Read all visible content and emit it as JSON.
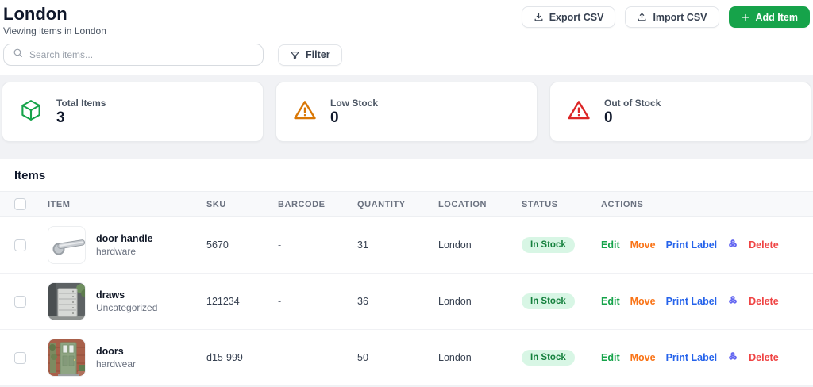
{
  "header": {
    "title": "London",
    "subtitle": "Viewing items in London",
    "export_label": "Export CSV",
    "import_label": "Import CSV",
    "add_label": "Add Item"
  },
  "toolbar": {
    "search_placeholder": "Search items...",
    "filter_label": "Filter"
  },
  "stats": [
    {
      "label": "Total Items",
      "value": "3",
      "icon": "package-icon"
    },
    {
      "label": "Low Stock",
      "value": "0",
      "icon": "warning-triangle-amber-icon"
    },
    {
      "label": "Out of Stock",
      "value": "0",
      "icon": "warning-triangle-red-icon"
    }
  ],
  "table": {
    "section_title": "Items",
    "columns": [
      "ITEM",
      "SKU",
      "BARCODE",
      "QUANTITY",
      "LOCATION",
      "STATUS",
      "ACTIONS"
    ],
    "actions": {
      "edit": "Edit",
      "move": "Move",
      "print_label": "Print Label",
      "delete": "Delete"
    },
    "rows": [
      {
        "name": "door handle",
        "category": "hardware",
        "sku": "5670",
        "barcode": "-",
        "quantity": "31",
        "location": "London",
        "status": "In Stock",
        "thumb": "door-handle-photo"
      },
      {
        "name": "draws",
        "category": "Uncategorized",
        "sku": "121234",
        "barcode": "-",
        "quantity": "36",
        "location": "London",
        "status": "In Stock",
        "thumb": "drawer-unit-photo"
      },
      {
        "name": "doors",
        "category": "hardwear",
        "sku": "d15-999",
        "barcode": "-",
        "quantity": "50",
        "location": "London",
        "status": "In Stock",
        "thumb": "green-door-photo"
      }
    ]
  },
  "colors": {
    "accent_green": "#16a34a",
    "warning_amber": "#d97706",
    "danger_red": "#dc2626",
    "link_blue": "#2563eb",
    "move_orange": "#f97316",
    "qr_indigo": "#6366f1",
    "badge_bg": "#d8f6e5",
    "badge_text": "#15803d",
    "page_bg": "#f1f2f5"
  }
}
